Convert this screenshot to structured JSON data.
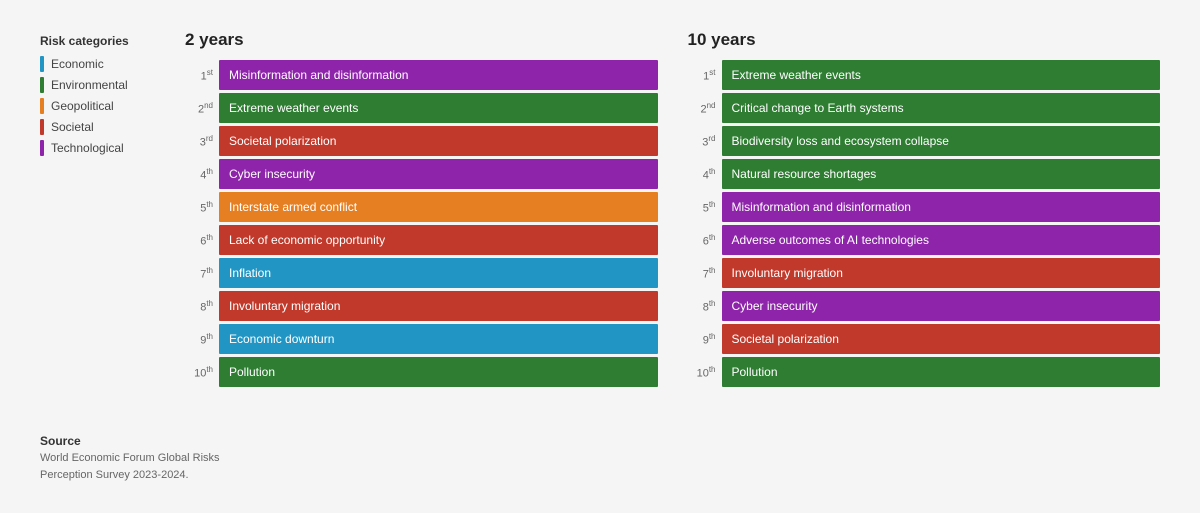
{
  "legend": {
    "title": "Risk categories",
    "items": [
      {
        "label": "Economic",
        "color": "#2196C4"
      },
      {
        "label": "Environmental",
        "color": "#2E7D32"
      },
      {
        "label": "Geopolitical",
        "color": "#E67E22"
      },
      {
        "label": "Societal",
        "color": "#C0392B"
      },
      {
        "label": "Technological",
        "color": "#8E24AA"
      }
    ]
  },
  "twoYears": {
    "title": "2 years",
    "rows": [
      {
        "rank": "1",
        "sup": "st",
        "label": "Misinformation and disinformation",
        "color": "#8E24AA"
      },
      {
        "rank": "2",
        "sup": "nd",
        "label": "Extreme weather events",
        "color": "#2E7D32"
      },
      {
        "rank": "3",
        "sup": "rd",
        "label": "Societal polarization",
        "color": "#C0392B"
      },
      {
        "rank": "4",
        "sup": "th",
        "label": "Cyber insecurity",
        "color": "#8E24AA"
      },
      {
        "rank": "5",
        "sup": "th",
        "label": "Interstate armed conflict",
        "color": "#E67E22"
      },
      {
        "rank": "6",
        "sup": "th",
        "label": "Lack of economic opportunity",
        "color": "#C0392B"
      },
      {
        "rank": "7",
        "sup": "th",
        "label": "Inflation",
        "color": "#2196C4"
      },
      {
        "rank": "8",
        "sup": "th",
        "label": "Involuntary migration",
        "color": "#C0392B"
      },
      {
        "rank": "9",
        "sup": "th",
        "label": "Economic downturn",
        "color": "#2196C4"
      },
      {
        "rank": "10",
        "sup": "th",
        "label": "Pollution",
        "color": "#2E7D32"
      }
    ]
  },
  "tenYears": {
    "title": "10 years",
    "rows": [
      {
        "rank": "1",
        "sup": "st",
        "label": "Extreme weather events",
        "color": "#2E7D32"
      },
      {
        "rank": "2",
        "sup": "nd",
        "label": "Critical change to Earth systems",
        "color": "#2E7D32"
      },
      {
        "rank": "3",
        "sup": "rd",
        "label": "Biodiversity loss and ecosystem collapse",
        "color": "#2E7D32"
      },
      {
        "rank": "4",
        "sup": "th",
        "label": "Natural resource shortages",
        "color": "#2E7D32"
      },
      {
        "rank": "5",
        "sup": "th",
        "label": "Misinformation and disinformation",
        "color": "#8E24AA"
      },
      {
        "rank": "6",
        "sup": "th",
        "label": "Adverse outcomes of AI technologies",
        "color": "#8E24AA"
      },
      {
        "rank": "7",
        "sup": "th",
        "label": "Involuntary migration",
        "color": "#C0392B"
      },
      {
        "rank": "8",
        "sup": "th",
        "label": "Cyber insecurity",
        "color": "#8E24AA"
      },
      {
        "rank": "9",
        "sup": "th",
        "label": "Societal polarization",
        "color": "#C0392B"
      },
      {
        "rank": "10",
        "sup": "th",
        "label": "Pollution",
        "color": "#2E7D32"
      }
    ]
  },
  "source": {
    "title": "Source",
    "text": "World Economic Forum Global Risks\nPerception Survey 2023-2024."
  }
}
